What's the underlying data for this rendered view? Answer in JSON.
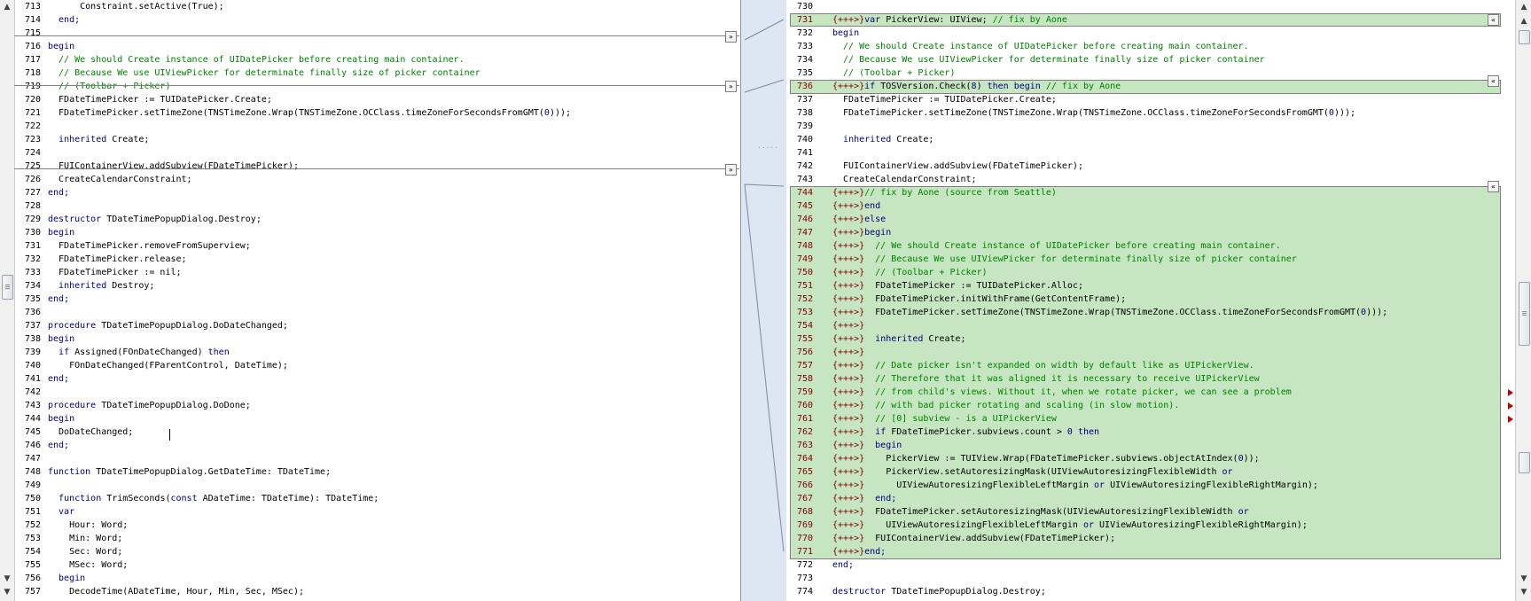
{
  "left_lines": [
    {
      "n": "713",
      "segs": [
        [
          "      Constraint.setActive(True);",
          ""
        ]
      ]
    },
    {
      "n": "714",
      "segs": [
        [
          "  end;",
          "kw"
        ]
      ]
    },
    {
      "n": "715",
      "segs": [
        [
          "",
          ""
        ]
      ]
    },
    {
      "n": "716",
      "segs": [
        [
          "begin",
          "kw"
        ]
      ]
    },
    {
      "n": "717",
      "segs": [
        [
          "  // We should Create instance of UIDatePicker before creating main container.",
          "cm"
        ]
      ]
    },
    {
      "n": "718",
      "segs": [
        [
          "  // Because We use UIViewPicker for determinate finally size of picker container",
          "cm"
        ]
      ]
    },
    {
      "n": "719",
      "segs": [
        [
          "  // (Toolbar + Picker)",
          "cm"
        ]
      ]
    },
    {
      "n": "720",
      "segs": [
        [
          "  FDateTimePicker := TUIDatePicker.Create;",
          ""
        ]
      ]
    },
    {
      "n": "721",
      "segs": [
        [
          "  FDateTimePicker.setTimeZone(TNSTimeZone.Wrap(TNSTimeZone.OCClass.timeZoneForSecondsFromGMT(",
          ""
        ],
        [
          "0",
          "num"
        ],
        [
          ")));",
          ""
        ]
      ]
    },
    {
      "n": "722",
      "segs": [
        [
          "",
          ""
        ]
      ]
    },
    {
      "n": "723",
      "segs": [
        [
          "  ",
          ""
        ],
        [
          "inherited",
          "kw"
        ],
        [
          " Create;",
          ""
        ]
      ]
    },
    {
      "n": "724",
      "segs": [
        [
          "",
          ""
        ]
      ]
    },
    {
      "n": "725",
      "segs": [
        [
          "  FUIContainerView.addSubview(FDateTimePicker);",
          ""
        ]
      ]
    },
    {
      "n": "726",
      "segs": [
        [
          "  CreateCalendarConstraint;",
          ""
        ]
      ]
    },
    {
      "n": "727",
      "segs": [
        [
          "end;",
          "kw"
        ]
      ]
    },
    {
      "n": "728",
      "segs": [
        [
          "",
          ""
        ]
      ]
    },
    {
      "n": "729",
      "segs": [
        [
          "destructor",
          "kw"
        ],
        [
          " TDateTimePopupDialog.Destroy;",
          ""
        ]
      ]
    },
    {
      "n": "730",
      "segs": [
        [
          "begin",
          "kw"
        ]
      ]
    },
    {
      "n": "731",
      "segs": [
        [
          "  FDateTimePicker.removeFromSuperview;",
          ""
        ]
      ]
    },
    {
      "n": "732",
      "segs": [
        [
          "  FDateTimePicker.release;",
          ""
        ]
      ]
    },
    {
      "n": "733",
      "segs": [
        [
          "  FDateTimePicker := nil;",
          ""
        ]
      ]
    },
    {
      "n": "734",
      "segs": [
        [
          "  ",
          ""
        ],
        [
          "inherited",
          "kw"
        ],
        [
          " Destroy;",
          ""
        ]
      ]
    },
    {
      "n": "735",
      "segs": [
        [
          "end;",
          "kw"
        ]
      ]
    },
    {
      "n": "736",
      "segs": [
        [
          "",
          ""
        ]
      ]
    },
    {
      "n": "737",
      "segs": [
        [
          "procedure",
          "kw"
        ],
        [
          " TDateTimePopupDialog.DoDateChanged;",
          ""
        ]
      ]
    },
    {
      "n": "738",
      "segs": [
        [
          "begin",
          "kw"
        ]
      ]
    },
    {
      "n": "739",
      "segs": [
        [
          "  ",
          ""
        ],
        [
          "if",
          "kw"
        ],
        [
          " Assigned(FOnDateChanged) ",
          ""
        ],
        [
          "then",
          "kw"
        ]
      ]
    },
    {
      "n": "740",
      "segs": [
        [
          "    FOnDateChanged(FParentControl, DateTime);",
          ""
        ]
      ]
    },
    {
      "n": "741",
      "segs": [
        [
          "end;",
          "kw"
        ]
      ]
    },
    {
      "n": "742",
      "segs": [
        [
          "",
          ""
        ]
      ]
    },
    {
      "n": "743",
      "segs": [
        [
          "procedure",
          "kw"
        ],
        [
          " TDateTimePopupDialog.DoDone;",
          ""
        ]
      ]
    },
    {
      "n": "744",
      "segs": [
        [
          "begin",
          "kw"
        ]
      ]
    },
    {
      "n": "745",
      "segs": [
        [
          "  DoDateChanged;",
          ""
        ]
      ]
    },
    {
      "n": "746",
      "segs": [
        [
          "end;",
          "kw"
        ]
      ]
    },
    {
      "n": "747",
      "segs": [
        [
          "",
          ""
        ]
      ]
    },
    {
      "n": "748",
      "segs": [
        [
          "function",
          "kw"
        ],
        [
          " TDateTimePopupDialog.GetDateTime: TDateTime;",
          ""
        ]
      ]
    },
    {
      "n": "749",
      "segs": [
        [
          "",
          ""
        ]
      ]
    },
    {
      "n": "750",
      "segs": [
        [
          "  ",
          ""
        ],
        [
          "function",
          "kw"
        ],
        [
          " TrimSeconds(",
          ""
        ],
        [
          "const",
          "kw"
        ],
        [
          " ADateTime: TDateTime): TDateTime;",
          ""
        ]
      ]
    },
    {
      "n": "751",
      "segs": [
        [
          "  var",
          "kw"
        ]
      ]
    },
    {
      "n": "752",
      "segs": [
        [
          "    Hour: Word;",
          ""
        ]
      ]
    },
    {
      "n": "753",
      "segs": [
        [
          "    Min: Word;",
          ""
        ]
      ]
    },
    {
      "n": "754",
      "segs": [
        [
          "    Sec: Word;",
          ""
        ]
      ]
    },
    {
      "n": "755",
      "segs": [
        [
          "    MSec: Word;",
          ""
        ]
      ]
    },
    {
      "n": "756",
      "segs": [
        [
          "  begin",
          "kw"
        ]
      ]
    },
    {
      "n": "757",
      "segs": [
        [
          "    DecodeTime(ADateTime, Hour, Min, Sec, MSec);",
          ""
        ]
      ]
    }
  ],
  "right_lines": [
    {
      "n": "730",
      "m": "",
      "segs": [
        [
          "",
          ""
        ]
      ]
    },
    {
      "n": "731",
      "m": "{+++>}",
      "segs": [
        [
          "var",
          "kw"
        ],
        [
          " PickerView: UIView; ",
          ""
        ],
        [
          "// fix by Aone",
          "cm"
        ]
      ]
    },
    {
      "n": "732",
      "m": "",
      "segs": [
        [
          "begin",
          "kw"
        ]
      ]
    },
    {
      "n": "733",
      "m": "",
      "segs": [
        [
          "  // We should Create instance of UIDatePicker before creating main container.",
          "cm"
        ]
      ]
    },
    {
      "n": "734",
      "m": "",
      "segs": [
        [
          "  // Because We use UIViewPicker for determinate finally size of picker container",
          "cm"
        ]
      ]
    },
    {
      "n": "735",
      "m": "",
      "segs": [
        [
          "  // (Toolbar + Picker)",
          "cm"
        ]
      ]
    },
    {
      "n": "736",
      "m": "{+++>}",
      "segs": [
        [
          "if",
          "kw"
        ],
        [
          " TOSVersion.Check(",
          ""
        ],
        [
          "8",
          "num"
        ],
        [
          ") ",
          ""
        ],
        [
          "then begin",
          "kw"
        ],
        [
          " ",
          ""
        ],
        [
          "// fix by Aone",
          "cm"
        ]
      ]
    },
    {
      "n": "737",
      "m": "",
      "segs": [
        [
          "  FDateTimePicker := TUIDatePicker.Create;",
          ""
        ]
      ]
    },
    {
      "n": "738",
      "m": "",
      "segs": [
        [
          "  FDateTimePicker.setTimeZone(TNSTimeZone.Wrap(TNSTimeZone.OCClass.timeZoneForSecondsFromGMT(",
          ""
        ],
        [
          "0",
          "num"
        ],
        [
          ")));",
          ""
        ]
      ]
    },
    {
      "n": "739",
      "m": "",
      "segs": [
        [
          "",
          ""
        ]
      ]
    },
    {
      "n": "740",
      "m": "",
      "segs": [
        [
          "  ",
          ""
        ],
        [
          "inherited",
          "kw"
        ],
        [
          " Create;",
          ""
        ]
      ]
    },
    {
      "n": "741",
      "m": "",
      "segs": [
        [
          "",
          ""
        ]
      ]
    },
    {
      "n": "742",
      "m": "",
      "segs": [
        [
          "  FUIContainerView.addSubview(FDateTimePicker);",
          ""
        ]
      ]
    },
    {
      "n": "743",
      "m": "",
      "segs": [
        [
          "  CreateCalendarConstraint;",
          ""
        ]
      ]
    },
    {
      "n": "744",
      "m": "{+++>}",
      "segs": [
        [
          "// fix by Aone (source from Seattle)",
          "cm"
        ]
      ]
    },
    {
      "n": "745",
      "m": "{+++>}",
      "segs": [
        [
          "end",
          "kw"
        ]
      ]
    },
    {
      "n": "746",
      "m": "{+++>}",
      "segs": [
        [
          "else",
          "kw"
        ]
      ]
    },
    {
      "n": "747",
      "m": "{+++>}",
      "segs": [
        [
          "begin",
          "kw"
        ]
      ]
    },
    {
      "n": "748",
      "m": "{+++>}",
      "segs": [
        [
          "  // We should Create instance of UIDatePicker before creating main container.",
          "cm"
        ]
      ]
    },
    {
      "n": "749",
      "m": "{+++>}",
      "segs": [
        [
          "  // Because We use UIViewPicker for determinate finally size of picker container",
          "cm"
        ]
      ]
    },
    {
      "n": "750",
      "m": "{+++>}",
      "segs": [
        [
          "  // (Toolbar + Picker)",
          "cm"
        ]
      ]
    },
    {
      "n": "751",
      "m": "{+++>}",
      "segs": [
        [
          "  FDateTimePicker := TUIDatePicker.Alloc;",
          ""
        ]
      ]
    },
    {
      "n": "752",
      "m": "{+++>}",
      "segs": [
        [
          "  FDateTimePicker.initWithFrame(GetContentFrame);",
          ""
        ]
      ]
    },
    {
      "n": "753",
      "m": "{+++>}",
      "segs": [
        [
          "  FDateTimePicker.setTimeZone(TNSTimeZone.Wrap(TNSTimeZone.OCClass.timeZoneForSecondsFromGMT(",
          ""
        ],
        [
          "0",
          "num"
        ],
        [
          ")));",
          ""
        ]
      ]
    },
    {
      "n": "754",
      "m": "{+++>}",
      "segs": [
        [
          "",
          ""
        ]
      ]
    },
    {
      "n": "755",
      "m": "{+++>}",
      "segs": [
        [
          "  ",
          ""
        ],
        [
          "inherited",
          "kw"
        ],
        [
          " Create;",
          ""
        ]
      ]
    },
    {
      "n": "756",
      "m": "{+++>}",
      "segs": [
        [
          "",
          ""
        ]
      ]
    },
    {
      "n": "757",
      "m": "{+++>}",
      "segs": [
        [
          "  // Date picker isn't expanded on width by default like as UIPickerView.",
          "cm"
        ]
      ]
    },
    {
      "n": "758",
      "m": "{+++>}",
      "segs": [
        [
          "  // Therefore that it was aligned it is necessary to receive UIPickerView",
          "cm"
        ]
      ]
    },
    {
      "n": "759",
      "m": "{+++>}",
      "segs": [
        [
          "  // from child's views. Without it, when we rotate picker, we can see a problem",
          "cm"
        ]
      ]
    },
    {
      "n": "760",
      "m": "{+++>}",
      "segs": [
        [
          "  // with bad picker rotating and scaling (in slow motion).",
          "cm"
        ]
      ]
    },
    {
      "n": "761",
      "m": "{+++>}",
      "segs": [
        [
          "  // [0] subview - is a UIPickerView",
          "cm"
        ]
      ]
    },
    {
      "n": "762",
      "m": "{+++>}",
      "segs": [
        [
          "  ",
          ""
        ],
        [
          "if",
          "kw"
        ],
        [
          " FDateTimePicker.subviews.count > ",
          ""
        ],
        [
          "0",
          "num"
        ],
        [
          " ",
          ""
        ],
        [
          "then",
          "kw"
        ]
      ]
    },
    {
      "n": "763",
      "m": "{+++>}",
      "segs": [
        [
          "  begin",
          "kw"
        ]
      ]
    },
    {
      "n": "764",
      "m": "{+++>}",
      "segs": [
        [
          "    PickerView := TUIView.Wrap(FDateTimePicker.subviews.objectAtIndex(",
          ""
        ],
        [
          "0",
          "num"
        ],
        [
          "));",
          ""
        ]
      ]
    },
    {
      "n": "765",
      "m": "{+++>}",
      "segs": [
        [
          "    PickerView.setAutoresizingMask(UIViewAutoresizingFlexibleWidth ",
          ""
        ],
        [
          "or",
          "kw"
        ]
      ]
    },
    {
      "n": "766",
      "m": "{+++>}",
      "segs": [
        [
          "      UIViewAutoresizingFlexibleLeftMargin ",
          ""
        ],
        [
          "or",
          "kw"
        ],
        [
          " UIViewAutoresizingFlexibleRightMargin);",
          ""
        ]
      ]
    },
    {
      "n": "767",
      "m": "{+++>}",
      "segs": [
        [
          "  end;",
          "kw"
        ]
      ]
    },
    {
      "n": "768",
      "m": "{+++>}",
      "segs": [
        [
          "  FDateTimePicker.setAutoresizingMask(UIViewAutoresizingFlexibleWidth ",
          ""
        ],
        [
          "or",
          "kw"
        ]
      ]
    },
    {
      "n": "769",
      "m": "{+++>}",
      "segs": [
        [
          "    UIViewAutoresizingFlexibleLeftMargin ",
          ""
        ],
        [
          "or",
          "kw"
        ],
        [
          " UIViewAutoresizingFlexibleRightMargin);",
          ""
        ]
      ]
    },
    {
      "n": "770",
      "m": "{+++>}",
      "segs": [
        [
          "  FUIContainerView.addSubview(FDateTimePicker);",
          ""
        ]
      ]
    },
    {
      "n": "771",
      "m": "{+++>}",
      "segs": [
        [
          "end;",
          "kw"
        ]
      ]
    },
    {
      "n": "772",
      "m": "",
      "segs": [
        [
          "end;",
          "kw"
        ]
      ]
    },
    {
      "n": "773",
      "m": "",
      "segs": [
        [
          "",
          ""
        ]
      ]
    },
    {
      "n": "774",
      "m": "",
      "segs": [
        [
          "destructor",
          "kw"
        ],
        [
          " TDateTimePopupDialog.Destroy;",
          ""
        ]
      ]
    }
  ],
  "icons": {
    "merge_right": "»",
    "merge_left": "«",
    "scroll_up": "▲",
    "scroll_down": "▼"
  },
  "gutter_dots": "....."
}
